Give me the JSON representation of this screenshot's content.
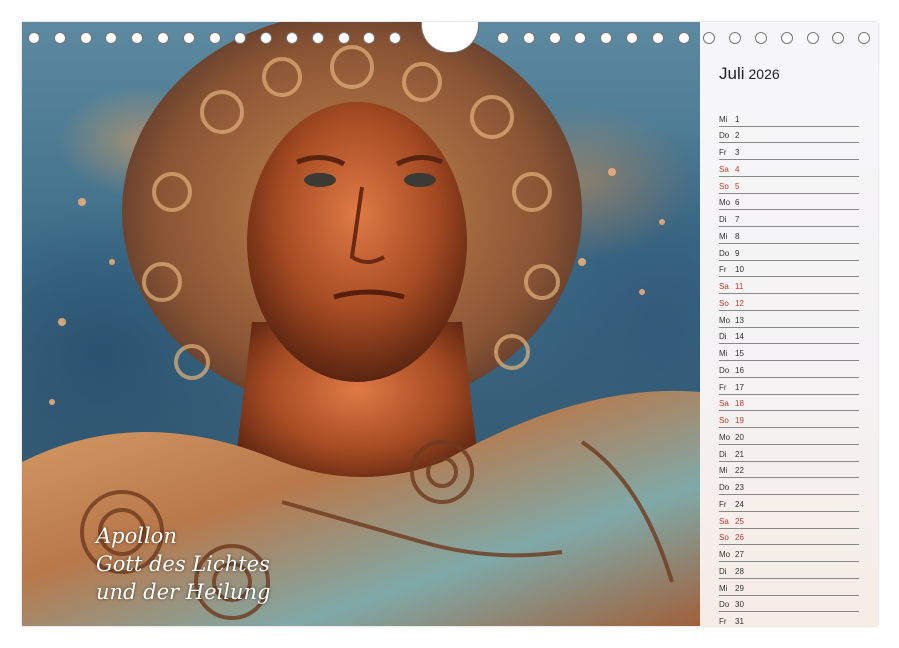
{
  "calendar": {
    "month": "Juli",
    "year": "2026",
    "days": [
      {
        "dn": "Mi",
        "d": "1",
        "we": false
      },
      {
        "dn": "Do",
        "d": "2",
        "we": false
      },
      {
        "dn": "Fr",
        "d": "3",
        "we": false
      },
      {
        "dn": "Sa",
        "d": "4",
        "we": true
      },
      {
        "dn": "So",
        "d": "5",
        "we": true
      },
      {
        "dn": "Mo",
        "d": "6",
        "we": false
      },
      {
        "dn": "Di",
        "d": "7",
        "we": false
      },
      {
        "dn": "Mi",
        "d": "8",
        "we": false
      },
      {
        "dn": "Do",
        "d": "9",
        "we": false
      },
      {
        "dn": "Fr",
        "d": "10",
        "we": false
      },
      {
        "dn": "Sa",
        "d": "11",
        "we": true
      },
      {
        "dn": "So",
        "d": "12",
        "we": true
      },
      {
        "dn": "Mo",
        "d": "13",
        "we": false
      },
      {
        "dn": "Di",
        "d": "14",
        "we": false
      },
      {
        "dn": "Mi",
        "d": "15",
        "we": false
      },
      {
        "dn": "Do",
        "d": "16",
        "we": false
      },
      {
        "dn": "Fr",
        "d": "17",
        "we": false
      },
      {
        "dn": "Sa",
        "d": "18",
        "we": true
      },
      {
        "dn": "So",
        "d": "19",
        "we": true
      },
      {
        "dn": "Mo",
        "d": "20",
        "we": false
      },
      {
        "dn": "Di",
        "d": "21",
        "we": false
      },
      {
        "dn": "Mi",
        "d": "22",
        "we": false
      },
      {
        "dn": "Do",
        "d": "23",
        "we": false
      },
      {
        "dn": "Fr",
        "d": "24",
        "we": false
      },
      {
        "dn": "Sa",
        "d": "25",
        "we": true
      },
      {
        "dn": "So",
        "d": "26",
        "we": true
      },
      {
        "dn": "Mo",
        "d": "27",
        "we": false
      },
      {
        "dn": "Di",
        "d": "28",
        "we": false
      },
      {
        "dn": "Mi",
        "d": "29",
        "we": false
      },
      {
        "dn": "Do",
        "d": "30",
        "we": false
      },
      {
        "dn": "Fr",
        "d": "31",
        "we": false
      }
    ]
  },
  "caption": {
    "line1": "Apollon",
    "line2": "Gott des Lichtes",
    "line3": "und der Heilung"
  },
  "colors": {
    "weekend": "#c0392b",
    "text": "#333333"
  }
}
